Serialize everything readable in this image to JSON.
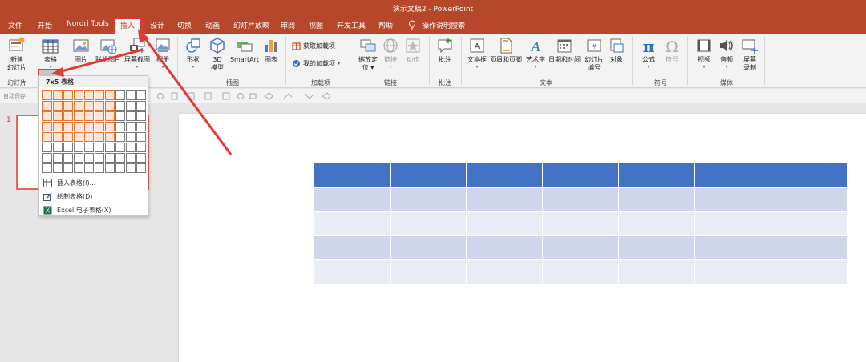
{
  "window": {
    "title": "演示文稿2  -  PowerPoint",
    "accent": "#b7472a"
  },
  "menu": {
    "tabs": [
      {
        "label": "文件"
      },
      {
        "label": "开始"
      },
      {
        "label": "Nordri Tools"
      },
      {
        "label": "插入",
        "active": true
      },
      {
        "label": "设计"
      },
      {
        "label": "切换"
      },
      {
        "label": "动画"
      },
      {
        "label": "幻灯片放映"
      },
      {
        "label": "审阅"
      },
      {
        "label": "视图"
      },
      {
        "label": "开发工具"
      },
      {
        "label": "帮助"
      }
    ],
    "search_label": "操作说明搜索"
  },
  "ribbon": {
    "slides": {
      "new_slide_l1": "新建",
      "new_slide_l2": "幻灯片",
      "group": "幻灯片"
    },
    "tables": {
      "table": "表格"
    },
    "images": {
      "picture": "图片",
      "online_picture": "联机图片",
      "screenshot": "屏幕截图",
      "album": "相册"
    },
    "illustrations": {
      "shapes": "形状",
      "model_3d_l1": "3D",
      "model_3d_l2": "模型",
      "smartart": "SmartArt",
      "chart": "图表",
      "group": "插图"
    },
    "addins": {
      "get_addins": "获取加载项",
      "my_addins": "我的加载项",
      "group": "加载项"
    },
    "links": {
      "zoom_l1": "缩放定",
      "zoom_l2": "位",
      "link": "链接",
      "action": "动作",
      "group": "链接"
    },
    "comments": {
      "comment": "批注",
      "group": "批注"
    },
    "text": {
      "textbox": "文本框",
      "header_footer": "页眉和页脚",
      "wordart": "艺术字",
      "datetime": "日期和时间",
      "slide_number_l1": "幻灯片",
      "slide_number_l2": "编号",
      "object": "对象",
      "group": "文本"
    },
    "symbols": {
      "equation": "公式",
      "symbol": "符号",
      "group": "符号"
    },
    "media": {
      "video": "视频",
      "audio": "音频",
      "screen_rec_l1": "屏幕",
      "screen_rec_l2": "录制",
      "group": "媒体"
    }
  },
  "qat": {
    "autosave": "自动保存"
  },
  "thumbnails": {
    "slide_number": "1"
  },
  "table_dropdown": {
    "header": "7x5 表格",
    "grid": {
      "cols": 10,
      "rows": 8,
      "sel_cols": 7,
      "sel_rows": 5
    },
    "items": [
      {
        "label": "插入表格(I)...",
        "icon": "insert-table-icon"
      },
      {
        "label": "绘制表格(D)",
        "icon": "draw-table-icon"
      },
      {
        "label": "Excel 电子表格(X)",
        "icon": "excel-icon"
      }
    ]
  },
  "slide_table": {
    "cols": 7,
    "rows": 5,
    "header_color": "#4472c4",
    "band1": "#cfd5ea",
    "band2": "#e9ebf5"
  }
}
